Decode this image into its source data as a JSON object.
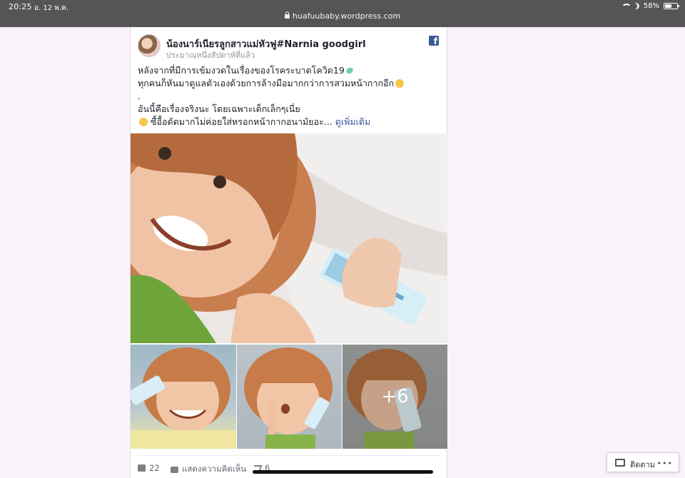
{
  "status_bar": {
    "time": "20:25",
    "date": "อ. 12 พ.ค.",
    "url": "huafuubaby.wordpress.com",
    "battery": "58%",
    "battery_level": 0.58
  },
  "post": {
    "author": "น้องนาร์เนียรลูกสาวแม่หัวฟู#Narnia goodgirl",
    "time_ago": "ประมาณหนึ่งสัปดาห์ที่แล้ว",
    "social_icon": "facebook-icon",
    "lines": [
      "หลังจากที่มีการเข้มงวดในเรื่องของโรคระบาดโควิด19",
      "ทุกคนก็หันมาดูแลตัวเองด้วยการล้างมือมากกว่าการสวมหน้ากากอีก",
      ".",
      "อันนี้คือเรื่องจริงนะ โดยเฉพาะเด็กเล็กๆเนี่ย",
      "ซื้อื้อดัดมากไม่ค่อยใส่หรอกหน้ากากอนามัยอะ..."
    ],
    "see_more": "ดูเพิ่มเติม",
    "more_photos": "+6"
  },
  "actions": {
    "likes": "22",
    "comment_label": "แสดงความคิดเห็น",
    "shares": "6"
  },
  "follow": {
    "label": "ติดตาม",
    "more": "•••"
  }
}
